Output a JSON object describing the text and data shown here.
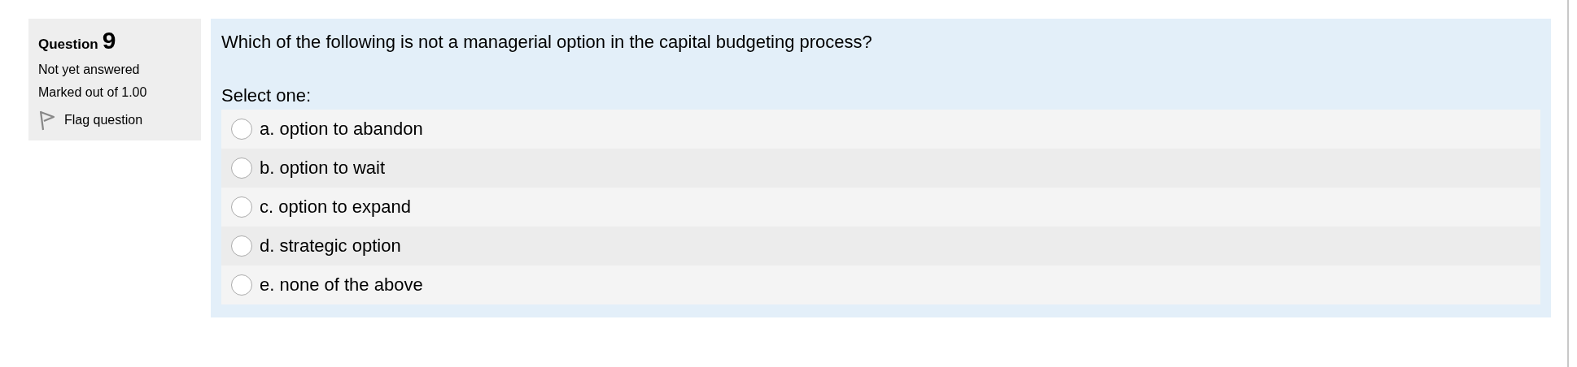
{
  "info": {
    "label": "Question",
    "number": "9",
    "status": "Not yet answered",
    "marks": "Marked out of 1.00",
    "flag": {
      "label": "Flag question",
      "flagged": false
    }
  },
  "question": {
    "text": "Which of the following is not a managerial option in the capital budgeting process?",
    "prompt": "Select one:",
    "options": [
      {
        "label": "a. option to abandon",
        "selected": false
      },
      {
        "label": "b. option to wait",
        "selected": false
      },
      {
        "label": "c. option to expand",
        "selected": false
      },
      {
        "label": "d. strategic option",
        "selected": false
      },
      {
        "label": "e. none of the above",
        "selected": false
      }
    ]
  }
}
